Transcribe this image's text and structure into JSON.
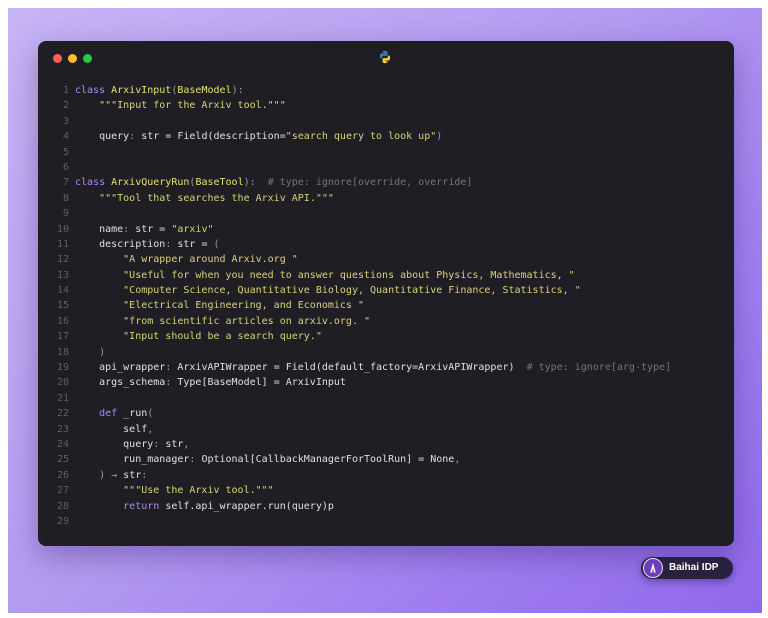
{
  "window": {
    "traffic_lights": [
      "close",
      "minimize",
      "zoom"
    ],
    "language_icon": "python-icon"
  },
  "code": {
    "lines": [
      {
        "n": "1",
        "tokens": [
          {
            "t": "class ",
            "c": "kw"
          },
          {
            "t": "ArxivInput",
            "c": "cls"
          },
          {
            "t": "(",
            "c": "pun"
          },
          {
            "t": "BaseModel",
            "c": "cls"
          },
          {
            "t": "):",
            "c": "pun"
          }
        ]
      },
      {
        "n": "2",
        "tokens": [
          {
            "t": "    \"\"\"Input for the Arxiv tool.\"\"\"",
            "c": "str"
          }
        ]
      },
      {
        "n": "3",
        "tokens": []
      },
      {
        "n": "4",
        "tokens": [
          {
            "t": "    query",
            "c": "fn"
          },
          {
            "t": ": ",
            "c": "pun"
          },
          {
            "t": "str = Field(description=",
            "c": "fn"
          },
          {
            "t": "\"search query to look up\"",
            "c": "str"
          },
          {
            "t": ")",
            "c": "pun"
          }
        ]
      },
      {
        "n": "5",
        "tokens": []
      },
      {
        "n": "6",
        "tokens": []
      },
      {
        "n": "7",
        "tokens": [
          {
            "t": "class ",
            "c": "kw"
          },
          {
            "t": "ArxivQueryRun",
            "c": "cls"
          },
          {
            "t": "(",
            "c": "pun"
          },
          {
            "t": "BaseTool",
            "c": "cls"
          },
          {
            "t": "):  ",
            "c": "pun"
          },
          {
            "t": "# type: ignore[override, override]",
            "c": "cmt"
          }
        ]
      },
      {
        "n": "8",
        "tokens": [
          {
            "t": "    \"\"\"Tool that searches the Arxiv API.\"\"\"",
            "c": "str"
          }
        ]
      },
      {
        "n": "9",
        "tokens": []
      },
      {
        "n": "10",
        "tokens": [
          {
            "t": "    name",
            "c": "fn"
          },
          {
            "t": ": ",
            "c": "pun"
          },
          {
            "t": "str = ",
            "c": "fn"
          },
          {
            "t": "\"arxiv\"",
            "c": "str"
          }
        ]
      },
      {
        "n": "11",
        "tokens": [
          {
            "t": "    description",
            "c": "fn"
          },
          {
            "t": ": ",
            "c": "pun"
          },
          {
            "t": "str = ",
            "c": "fn"
          },
          {
            "t": "(",
            "c": "pun"
          }
        ]
      },
      {
        "n": "12",
        "tokens": [
          {
            "t": "        \"A wrapper around Arxiv.org \"",
            "c": "str"
          }
        ]
      },
      {
        "n": "13",
        "tokens": [
          {
            "t": "        \"Useful for when you need to answer questions about Physics, Mathematics, \"",
            "c": "str"
          }
        ]
      },
      {
        "n": "14",
        "tokens": [
          {
            "t": "        \"Computer Science, Quantitative Biology, Quantitative Finance, Statistics, \"",
            "c": "str"
          }
        ]
      },
      {
        "n": "15",
        "tokens": [
          {
            "t": "        \"Electrical Engineering, and Economics \"",
            "c": "str"
          }
        ]
      },
      {
        "n": "16",
        "tokens": [
          {
            "t": "        \"from scientific articles on arxiv.org. \"",
            "c": "str"
          }
        ]
      },
      {
        "n": "17",
        "tokens": [
          {
            "t": "        \"Input should be a search query.\"",
            "c": "str"
          }
        ]
      },
      {
        "n": "18",
        "tokens": [
          {
            "t": "    )",
            "c": "pun"
          }
        ]
      },
      {
        "n": "19",
        "tokens": [
          {
            "t": "    api_wrapper",
            "c": "fn"
          },
          {
            "t": ": ",
            "c": "pun"
          },
          {
            "t": "ArxivAPIWrapper = Field(default_factory=ArxivAPIWrapper)  ",
            "c": "fn"
          },
          {
            "t": "# type: ignore[arg-type]",
            "c": "cmt"
          }
        ]
      },
      {
        "n": "20",
        "tokens": [
          {
            "t": "    args_schema",
            "c": "fn"
          },
          {
            "t": ": ",
            "c": "pun"
          },
          {
            "t": "Type[BaseModel] = ArxivInput",
            "c": "fn"
          }
        ]
      },
      {
        "n": "21",
        "tokens": []
      },
      {
        "n": "22",
        "tokens": [
          {
            "t": "    def ",
            "c": "kw"
          },
          {
            "t": "_run",
            "c": "fn"
          },
          {
            "t": "(",
            "c": "pun"
          }
        ]
      },
      {
        "n": "23",
        "tokens": [
          {
            "t": "        self",
            "c": "fn"
          },
          {
            "t": ",",
            "c": "pun"
          }
        ]
      },
      {
        "n": "24",
        "tokens": [
          {
            "t": "        query",
            "c": "fn"
          },
          {
            "t": ": ",
            "c": "pun"
          },
          {
            "t": "str",
            "c": "fn"
          },
          {
            "t": ",",
            "c": "pun"
          }
        ]
      },
      {
        "n": "25",
        "tokens": [
          {
            "t": "        run_manager",
            "c": "fn"
          },
          {
            "t": ": ",
            "c": "pun"
          },
          {
            "t": "Optional[CallbackManagerForToolRun] = None",
            "c": "fn"
          },
          {
            "t": ",",
            "c": "pun"
          }
        ]
      },
      {
        "n": "26",
        "tokens": [
          {
            "t": "    ) ",
            "c": "pun"
          },
          {
            "t": "→",
            "c": "kw"
          },
          {
            "t": " str",
            "c": "fn"
          },
          {
            "t": ":",
            "c": "pun"
          }
        ]
      },
      {
        "n": "27",
        "tokens": [
          {
            "t": "        \"\"\"Use the Arxiv tool.\"\"\"",
            "c": "str"
          }
        ]
      },
      {
        "n": "28",
        "tokens": [
          {
            "t": "        return ",
            "c": "kw"
          },
          {
            "t": "self.api_wrapper.run(query)p",
            "c": "fn"
          }
        ]
      },
      {
        "n": "29",
        "tokens": []
      }
    ]
  },
  "badge": {
    "label": "Baihai IDP",
    "icon": "baihai-logo-icon"
  }
}
